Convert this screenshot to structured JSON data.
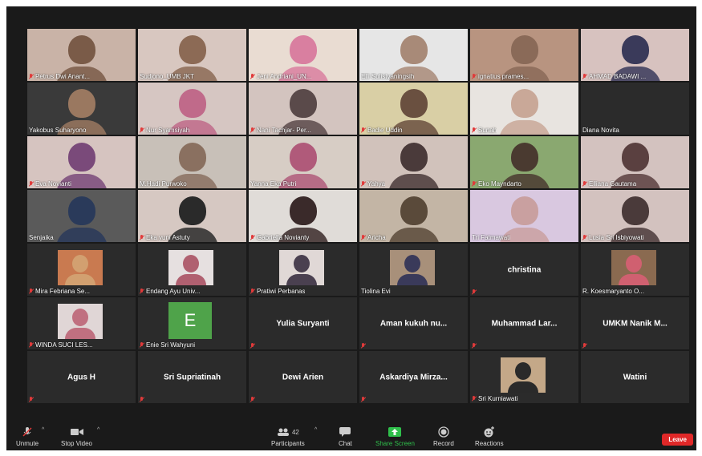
{
  "participants": [
    {
      "name": "Petrus Dwi Anant...",
      "muted": true,
      "kind": "video",
      "bg": "#c9b3a7",
      "face": "#7a5b48"
    },
    {
      "name": "Sudjono_UMB JKT",
      "muted": false,
      "kind": "video",
      "bg": "#d8c7c0",
      "face": "#8c6a55"
    },
    {
      "name": "Jeni Andriani_UN...",
      "muted": true,
      "kind": "video",
      "bg": "#e9dcd2",
      "face": "#d97fa0"
    },
    {
      "name": "Elli Sulistyaningsih",
      "muted": false,
      "kind": "video",
      "bg": "#e6e6e6",
      "face": "#a88a78"
    },
    {
      "name": "ignatius prames...",
      "muted": true,
      "kind": "video",
      "bg": "#b89480",
      "face": "#8a6a58"
    },
    {
      "name": "AHMAD BADAWI ...",
      "muted": true,
      "kind": "video",
      "bg": "#d7c2bf",
      "face": "#3a3a5a"
    },
    {
      "name": "Yakobus Suharyono",
      "muted": false,
      "kind": "video",
      "bg": "#3a3a3a",
      "face": "#9a7860"
    },
    {
      "name": "Nur Syamsiyah",
      "muted": true,
      "kind": "video",
      "bg": "#d6c6c2",
      "face": "#c06a8a"
    },
    {
      "name": "Nani Tachjar- Per...",
      "muted": true,
      "kind": "video",
      "bg": "#d3c4bf",
      "face": "#5a4a4a"
    },
    {
      "name": "Badie Uddin",
      "muted": true,
      "kind": "video",
      "bg": "#d9cfa5",
      "face": "#6a5040"
    },
    {
      "name": "Sunah",
      "muted": true,
      "kind": "video",
      "bg": "#e8e4e0",
      "face": "#c9a898"
    },
    {
      "name": "Diana Novita",
      "muted": false,
      "kind": "black",
      "bg": "#1e1e1e",
      "face": ""
    },
    {
      "name": "Eva Novianti",
      "muted": true,
      "kind": "video",
      "bg": "#d6c4c0",
      "face": "#7a4a7a"
    },
    {
      "name": "M.Hadi Purwoko",
      "muted": false,
      "kind": "video",
      "bg": "#c8c0b8",
      "face": "#8a7060"
    },
    {
      "name": "Yanna Eka Putri",
      "muted": false,
      "kind": "video",
      "bg": "#d7cdc5",
      "face": "#b05a7a"
    },
    {
      "name": "Yahya",
      "muted": true,
      "kind": "video",
      "bg": "#d1c2bb",
      "face": "#4a3a3a"
    },
    {
      "name": "Eko Mayndarto",
      "muted": true,
      "kind": "video",
      "bg": "#8aa870",
      "face": "#4a3a30"
    },
    {
      "name": "Elliana Gautama",
      "muted": true,
      "kind": "video",
      "bg": "#d3c2bf",
      "face": "#5a4040"
    },
    {
      "name": "Senjaika",
      "muted": false,
      "kind": "video",
      "bg": "#5a5a5a",
      "face": "#2a3a5a",
      "active": true
    },
    {
      "name": "Eka yuni Astuty",
      "muted": true,
      "kind": "video",
      "bg": "#d6c8c2",
      "face": "#2a2a2a"
    },
    {
      "name": "Gabriella Novianty",
      "muted": true,
      "kind": "video",
      "bg": "#e0dcd8",
      "face": "#3a2a2a"
    },
    {
      "name": "Aricha",
      "muted": true,
      "kind": "video",
      "bg": "#c3b5a5",
      "face": "#5a4a3a"
    },
    {
      "name": "Tri Fatmawati",
      "muted": false,
      "kind": "video",
      "bg": "#d9c8e0",
      "face": "#c9a0a0"
    },
    {
      "name": "Lusia Sri Isbiyowati",
      "muted": true,
      "kind": "video",
      "bg": "#d3c2bf",
      "face": "#4a3a3a"
    },
    {
      "name": "Mira Febriana Se...",
      "muted": true,
      "kind": "small",
      "bg": "#c97a50",
      "face": "#d2a070"
    },
    {
      "name": "Endang Ayu Univ...",
      "muted": true,
      "kind": "small",
      "bg": "#e6e0e0",
      "face": "#b06070"
    },
    {
      "name": "Pratiwi Perbanas",
      "muted": true,
      "kind": "small",
      "bg": "#e0d8d6",
      "face": "#4a4050"
    },
    {
      "name": "Tiolina Evi",
      "muted": false,
      "kind": "small",
      "bg": "#a8907a",
      "face": "#3a3a5a"
    },
    {
      "name": "christina",
      "muted": true,
      "kind": "text"
    },
    {
      "name": "R. Koesmaryanto O...",
      "muted": false,
      "kind": "small",
      "bg": "#8a6a50",
      "face": "#d06070"
    },
    {
      "name": "WINDA SUCI LES...",
      "muted": true,
      "kind": "small",
      "bg": "#e0d6d6",
      "face": "#c07080"
    },
    {
      "name": "Enie Sri Wahyuni",
      "muted": true,
      "kind": "letter",
      "letter": "E"
    },
    {
      "name": "Yulia Suryanti",
      "muted": true,
      "kind": "text"
    },
    {
      "name": "Aman kukuh nu...",
      "muted": true,
      "kind": "text"
    },
    {
      "name": "Muhammad Lar...",
      "muted": true,
      "kind": "text"
    },
    {
      "name": "UMKM Nanik M...",
      "muted": true,
      "kind": "text"
    },
    {
      "name": "Agus H",
      "muted": true,
      "kind": "text"
    },
    {
      "name": "Sri Supriatinah",
      "muted": true,
      "kind": "text"
    },
    {
      "name": "Dewi Arien",
      "muted": true,
      "kind": "text"
    },
    {
      "name": "Askardiya Mirza...",
      "muted": true,
      "kind": "text"
    },
    {
      "name": "Sri Kurniawati",
      "muted": true,
      "kind": "small",
      "bg": "#c4a888",
      "face": "#2a2a2a"
    },
    {
      "name": "Watini",
      "muted": false,
      "kind": "text"
    }
  ],
  "toolbar": {
    "unmute": "Unmute",
    "stop_video": "Stop Video",
    "participants": "Participants",
    "participants_count": "42",
    "chat": "Chat",
    "share_screen": "Share Screen",
    "record": "Record",
    "reactions": "Reactions",
    "leave": "Leave"
  },
  "colors": {
    "background": "#1a1a1a",
    "tile": "#2b2b2b",
    "active_speaker": "#d9e36b",
    "share_green": "#2fbf4b",
    "leave_red": "#e02828",
    "muted_red": "#e03a3a"
  }
}
